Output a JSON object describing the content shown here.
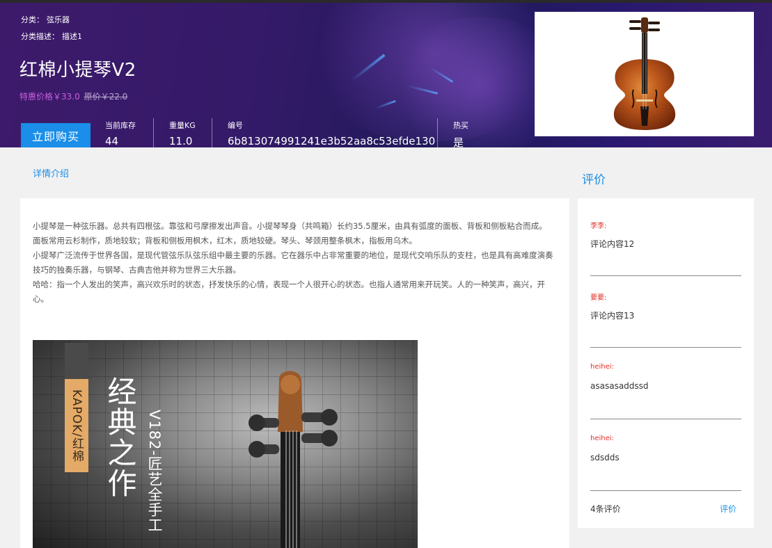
{
  "header": {
    "category_label": "分类：",
    "category_value": "弦乐器",
    "category_desc_label": "分类描述：",
    "category_desc_value": "描述1",
    "title": "红棉小提琴V2",
    "special_price": "特惠价格￥33.0",
    "original_price": "原价￥22.0",
    "buy_button": "立即购买",
    "stats": [
      {
        "label": "当前库存",
        "value": "44"
      },
      {
        "label": "重量KG",
        "value": "11.0"
      },
      {
        "label": "编号",
        "value": "6b813074991241e3b52aa8c53efde130"
      },
      {
        "label": "热买",
        "value": "是"
      }
    ]
  },
  "detail": {
    "section_link": "详情介绍",
    "paragraphs": [
      "小提琴是一种弦乐器。总共有四根弦。靠弦和弓摩擦发出声音。小提琴琴身（共鸣箱）长约35.5厘米，由具有弧度的面板、背板和侧板粘合而成。",
      "面板常用云杉制作，质地较软；背板和侧板用枫木，红木，质地较硬。琴头、琴颈用整条枫木，指板用乌木。",
      "小提琴广泛流传于世界各国，是现代管弦乐队弦乐组中最主要的乐器。它在器乐中占非常重要的地位，是现代交响乐队的支柱，也是具有高难度演奏技巧的独奏乐器，与钢琴、古典吉他并称为世界三大乐器。",
      "哈哈：指一个人发出的笑声，高兴欢乐时的状态，抒发快乐的心情，表现一个人很开心的状态。也指人通常用来开玩笑。人的一种笑声，高兴，开心。"
    ],
    "image": {
      "brand": "KAPOK/红棉",
      "headline": "经典之作",
      "model": "V182-匠艺全手工"
    }
  },
  "reviews": {
    "heading": "评价",
    "items": [
      {
        "name": "李李:",
        "content": "评论内容12"
      },
      {
        "name": "要要:",
        "content": "评论内容13"
      },
      {
        "name": "heihei:",
        "content": "asasasaddssd"
      },
      {
        "name": "heihei:",
        "content": "sdsdds"
      }
    ],
    "count": "4条评价",
    "rate_link": "评价"
  },
  "colors": {
    "accent": "#1a8ee8",
    "special_price": "#c95fe0",
    "reviewer_name": "#e0302a",
    "banner_bg": "#2a1a66"
  }
}
